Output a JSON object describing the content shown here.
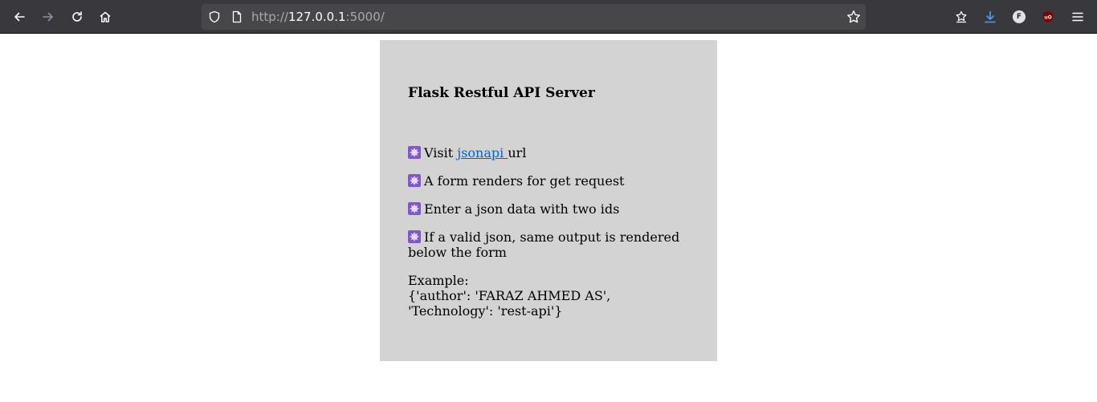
{
  "browser": {
    "url_scheme": "http://",
    "url_host": "127.0.0.1",
    "url_port": ":5000/",
    "icons": [
      "back-icon",
      "forward-icon",
      "reload-icon",
      "home-icon",
      "shield-icon",
      "page-icon",
      "bookmark-star-icon",
      "pocket-icon",
      "download-icon",
      "firefox-account-icon",
      "ublock-icon",
      "menu-icon"
    ],
    "accent": "#45a1ff"
  },
  "page": {
    "title": "Flask Restful API Server",
    "item1_prefix": "Visit ",
    "item1_link": "jsonapi ",
    "item1_suffix": "url",
    "item2": "A form renders for get request",
    "item3": "Enter a json data with two ids",
    "item4": "If a valid json, same output is rendered below the form",
    "example_label": "Example:",
    "example_value": "{'author': 'FARAZ AHMED AS', 'Technology': 'rest-api'}",
    "card_bg": "#d3d3d3",
    "bullet_icon": "ship-wheel-icon",
    "bullet_color": "#7f57c9"
  }
}
